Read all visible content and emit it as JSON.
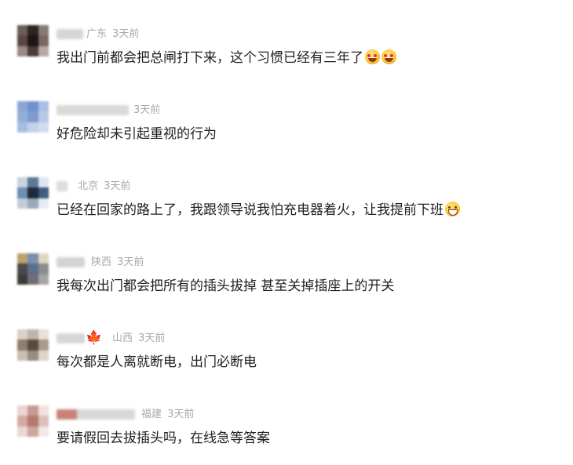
{
  "comments": [
    {
      "location": "广东",
      "time": "3天前",
      "text": "我出门前都会把总闸打下来，这个习惯已经有三年了",
      "emojis": [
        "heart-eyes-smiley-icon",
        "heart-eyes-smiley-icon"
      ]
    },
    {
      "location": "",
      "time": "3天前",
      "text": "好危险却未引起重视的行为",
      "emojis": []
    },
    {
      "location": "北京",
      "time": "3天前",
      "text": "已经在回家的路上了，我跟领导说我怕充电器着火，让我提前下班",
      "emojis": [
        "grinning-smiley-icon"
      ]
    },
    {
      "location": "陕西",
      "time": "3天前",
      "text": "我每次出门都会把所有的插头拔掉 甚至关掉插座上的开关",
      "emojis": []
    },
    {
      "location": "山西",
      "time": "3天前",
      "text": "每次都是人离就断电，出门必断电",
      "emojis": [],
      "badge": "maple-leaf-icon"
    },
    {
      "location": "福建",
      "time": "3天前",
      "text": "要请假回去拔插头吗，在线急等答案",
      "emojis": []
    }
  ],
  "colors": {
    "meta": "#a8a8a8",
    "text": "#1f1f1f",
    "background": "#ffffff"
  }
}
